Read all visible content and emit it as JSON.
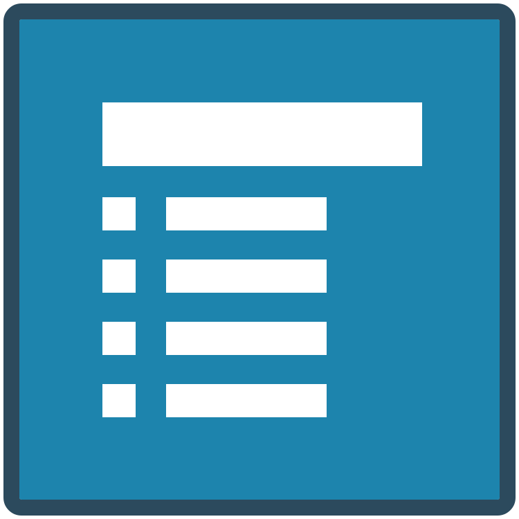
{
  "icon": {
    "name": "list-document-icon",
    "colors": {
      "border": "#2c4a5d",
      "background": "#1d84ad",
      "foreground": "#ffffff"
    },
    "list_rows": 4
  }
}
